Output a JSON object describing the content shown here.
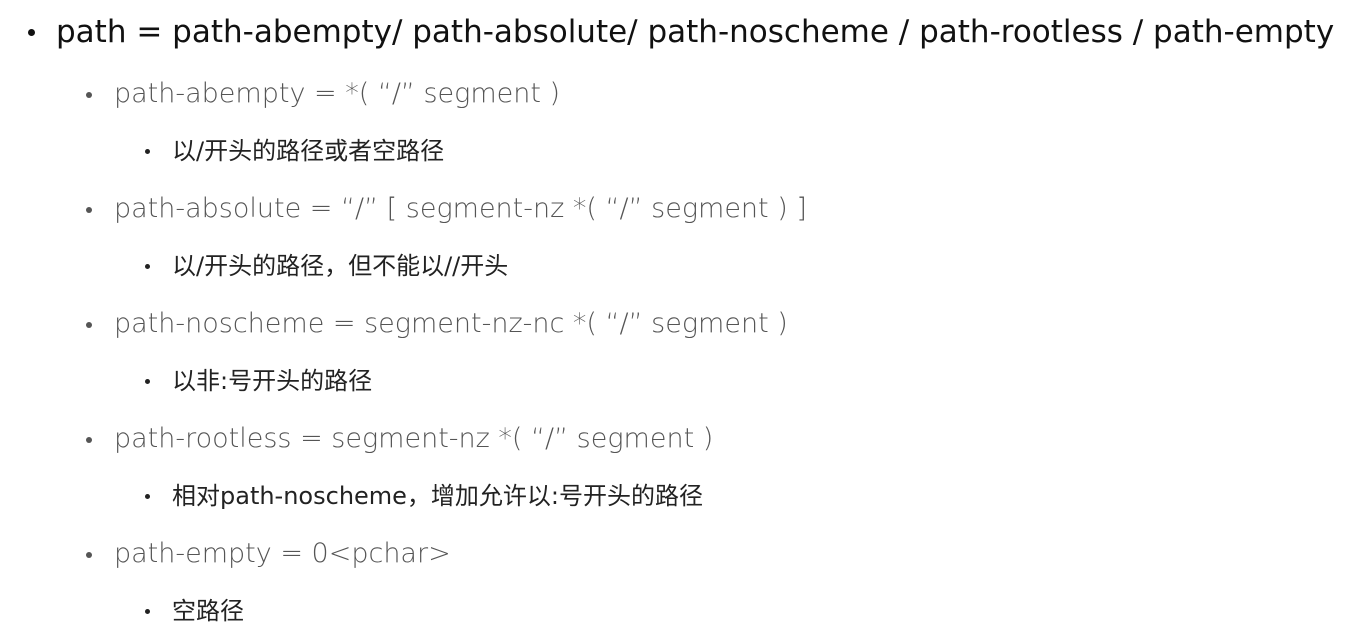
{
  "items": [
    {
      "text": "path = path-abempty/ path-absolute/ path-noscheme / path-rootless / path-empty",
      "children": [
        {
          "text": "path-abempty = *( “/” segment )",
          "note": "以/开头的路径或者空路径"
        },
        {
          "text": "path-absolute = “/” [ segment-nz *( “/” segment ) ]",
          "note": "以/开头的路径，但不能以//开头"
        },
        {
          "text": "path-noscheme = segment-nz-nc *( “/” segment )",
          "note": "以非:号开头的路径"
        },
        {
          "text": "path-rootless = segment-nz *( “/” segment )",
          "note": "相对path-noscheme，增加允许以:号开头的路径"
        },
        {
          "text": "path-empty = 0<pchar>",
          "note": "空路径"
        }
      ]
    }
  ]
}
